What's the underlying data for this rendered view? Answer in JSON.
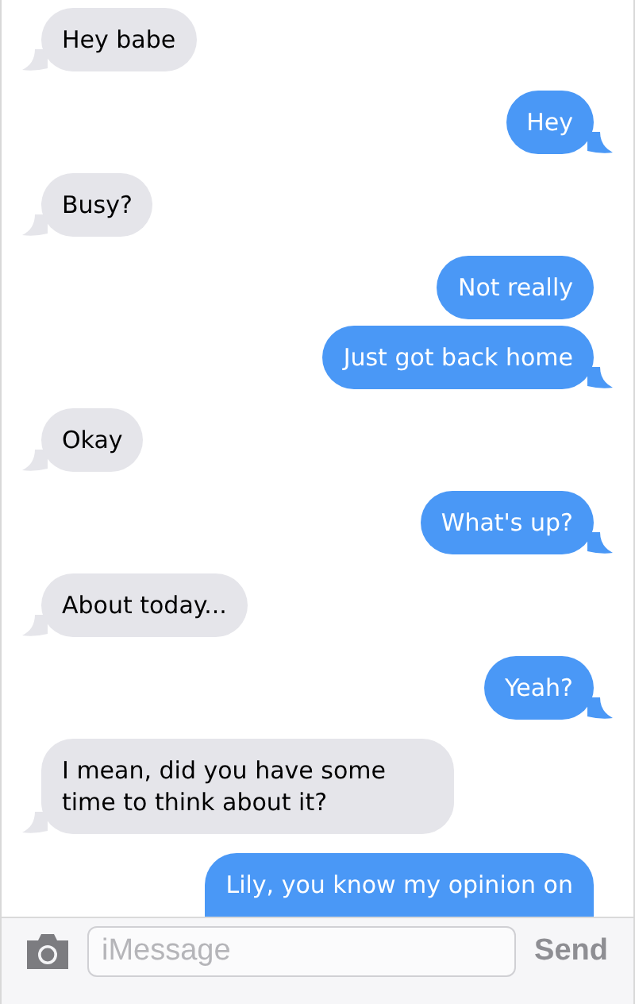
{
  "messages": [
    {
      "kind": "incoming",
      "text": "Hey babe"
    },
    {
      "kind": "outgoing",
      "text": "Hey"
    },
    {
      "kind": "incoming",
      "text": "Busy?"
    },
    {
      "kind": "outgoing",
      "text": "Not really"
    },
    {
      "kind": "outgoing",
      "text": "Just got back home"
    },
    {
      "kind": "incoming",
      "text": "Okay"
    },
    {
      "kind": "outgoing",
      "text": "What's up?"
    },
    {
      "kind": "incoming",
      "text": "About today..."
    },
    {
      "kind": "outgoing",
      "text": "Yeah?"
    },
    {
      "kind": "incoming",
      "text": "I mean, did you have some time to think about it?"
    },
    {
      "kind": "outgoing",
      "text": "Lily, you know my opinion on"
    }
  ],
  "composer": {
    "placeholder": "iMessage",
    "send_label": "Send"
  }
}
